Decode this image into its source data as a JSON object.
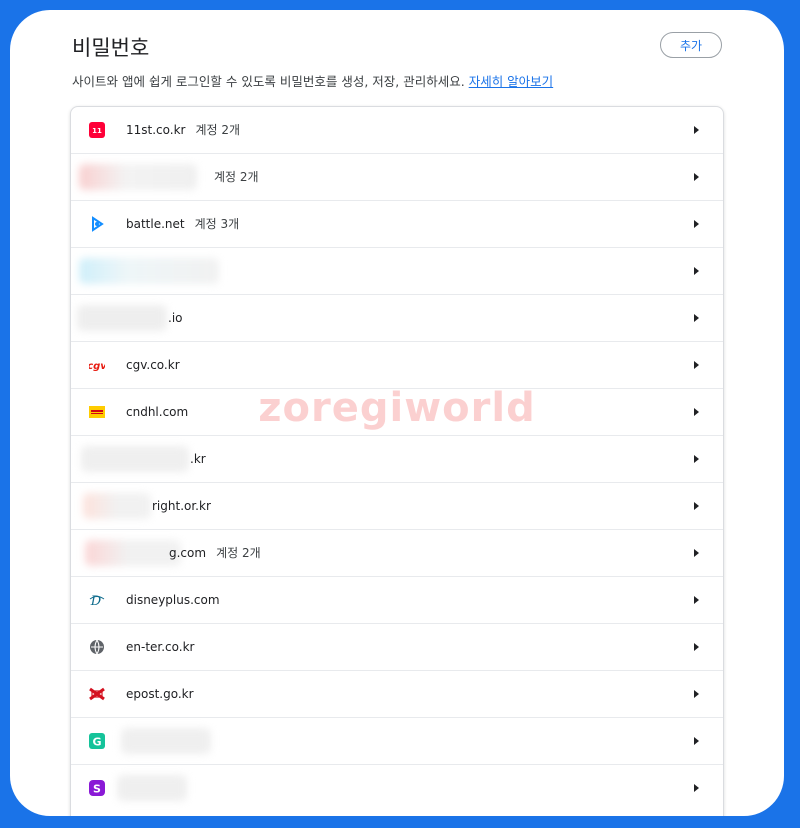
{
  "header": {
    "title": "비밀번호",
    "add_label": "추가",
    "description": "사이트와 앱에 쉽게 로그인할 수 있도록 비밀번호를 생성, 저장, 관리하세요.",
    "learn_more": "자세히 알아보기"
  },
  "rows": [
    {
      "site": "11st.co.kr",
      "count": "계정 2개",
      "icon": "11st-icon"
    },
    {
      "site": "",
      "count": "계정 2개",
      "icon": "blurred"
    },
    {
      "site": "battle.net",
      "count": "계정 3개",
      "icon": "battlenet-icon"
    },
    {
      "site": "",
      "count": "",
      "icon": "blurred"
    },
    {
      "site": ".io",
      "count": "",
      "icon": "blurred"
    },
    {
      "site": "cgv.co.kr",
      "count": "",
      "icon": "cgv-icon"
    },
    {
      "site": "cndhl.com",
      "count": "",
      "icon": "dhl-icon"
    },
    {
      "site": ".kr",
      "count": "",
      "icon": "blurred"
    },
    {
      "site": "right.or.kr",
      "count": "",
      "icon": "blurred"
    },
    {
      "site": "g.com",
      "count": "계정 2개",
      "icon": "blurred"
    },
    {
      "site": "disneyplus.com",
      "count": "",
      "icon": "disney-icon"
    },
    {
      "site": "en-ter.co.kr",
      "count": "",
      "icon": "globe-icon"
    },
    {
      "site": "epost.go.kr",
      "count": "",
      "icon": "epost-icon"
    },
    {
      "site": "",
      "count": "",
      "icon": "g-green-icon"
    },
    {
      "site": "",
      "count": "",
      "icon": "s-purple-icon"
    }
  ],
  "watermark": "zoregiworld",
  "colors": {
    "accent": "#1a73e8",
    "frame": "#1a73e8"
  }
}
